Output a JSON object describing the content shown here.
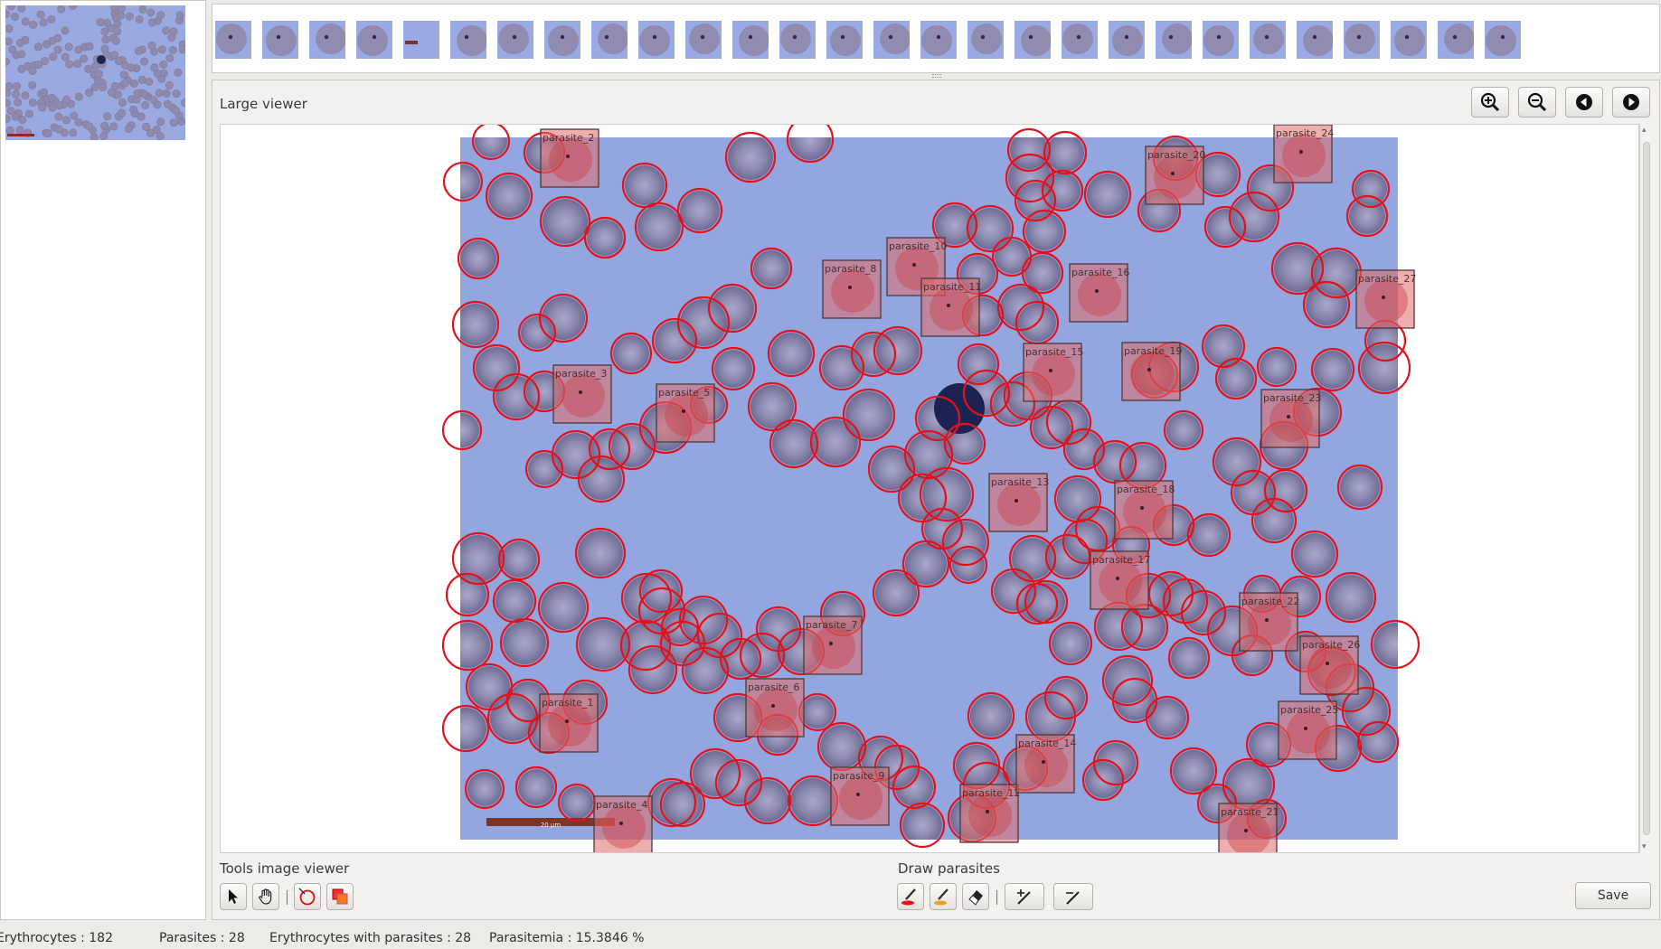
{
  "viewer": {
    "title": "Large viewer",
    "zoom_in_icon": "zoom-in-icon",
    "zoom_out_icon": "zoom-out-icon",
    "prev_icon": "previous-icon",
    "next_icon": "next-icon",
    "scale_bar_label": "20 µm"
  },
  "tools": {
    "section_label": "Tools image viewer",
    "items": [
      "select-arrow-icon",
      "pan-hand-icon",
      "draw-circle-icon",
      "draw-rectangle-icon"
    ]
  },
  "draw": {
    "section_label": "Draw parasites",
    "items": [
      "red-marker-icon",
      "orange-marker-icon",
      "eraser-icon",
      "add-point-icon",
      "remove-point-icon"
    ]
  },
  "save_label": "Save",
  "status": {
    "erythrocytes": "Erythrocytes : 182",
    "parasites": "Parasites : 28",
    "with_parasites": "Erythrocytes with parasites : 28",
    "parasitemia": "Parasitemia : 15.3846 %"
  },
  "parasites": [
    {
      "label": "parasite_1"
    },
    {
      "label": "parasite_2"
    },
    {
      "label": "parasite_3"
    },
    {
      "label": "parasite_4"
    },
    {
      "label": "parasite_5"
    },
    {
      "label": "parasite_6"
    },
    {
      "label": "parasite_7"
    },
    {
      "label": "parasite_8"
    },
    {
      "label": "parasite_9"
    },
    {
      "label": "parasite_10"
    },
    {
      "label": "parasite_11"
    },
    {
      "label": "parasite_12"
    },
    {
      "label": "parasite_13"
    },
    {
      "label": "parasite_14"
    },
    {
      "label": "parasite_15"
    },
    {
      "label": "parasite_16"
    },
    {
      "label": "parasite_17"
    },
    {
      "label": "parasite_18"
    },
    {
      "label": "parasite_19"
    },
    {
      "label": "parasite_20"
    },
    {
      "label": "parasite_21"
    },
    {
      "label": "parasite_22"
    },
    {
      "label": "parasite_23"
    },
    {
      "label": "parasite_24"
    },
    {
      "label": "parasite_25"
    },
    {
      "label": "parasite_26"
    },
    {
      "label": "parasite_27"
    },
    {
      "label": "parasite_28"
    }
  ],
  "colors": {
    "background_blue": "#94a6e0",
    "cell_gray": "#8b88b0",
    "detection_circle": "#e3111b",
    "parasite_box": "#e57878"
  }
}
